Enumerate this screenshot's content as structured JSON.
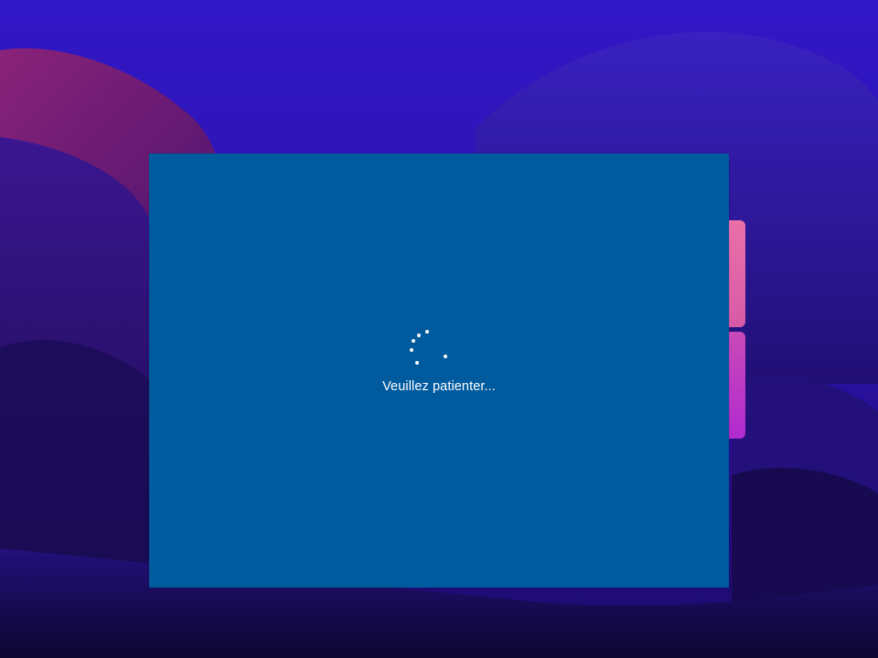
{
  "desktop": {
    "wallpaper": "abstract-purple-hills",
    "logo_icon": "windows-logo-icon",
    "colors": {
      "sky": "#2a13a8",
      "hill_magenta": "#7a1d7e",
      "hill_dark": "#1a0a4a",
      "logo_pink": "#e060a8",
      "logo_magenta": "#c030c8"
    }
  },
  "vm_screen": {
    "background_color": "#005a9e",
    "spinner_icon": "loading-spinner-icon",
    "status_text": "Veuillez patienter..."
  }
}
